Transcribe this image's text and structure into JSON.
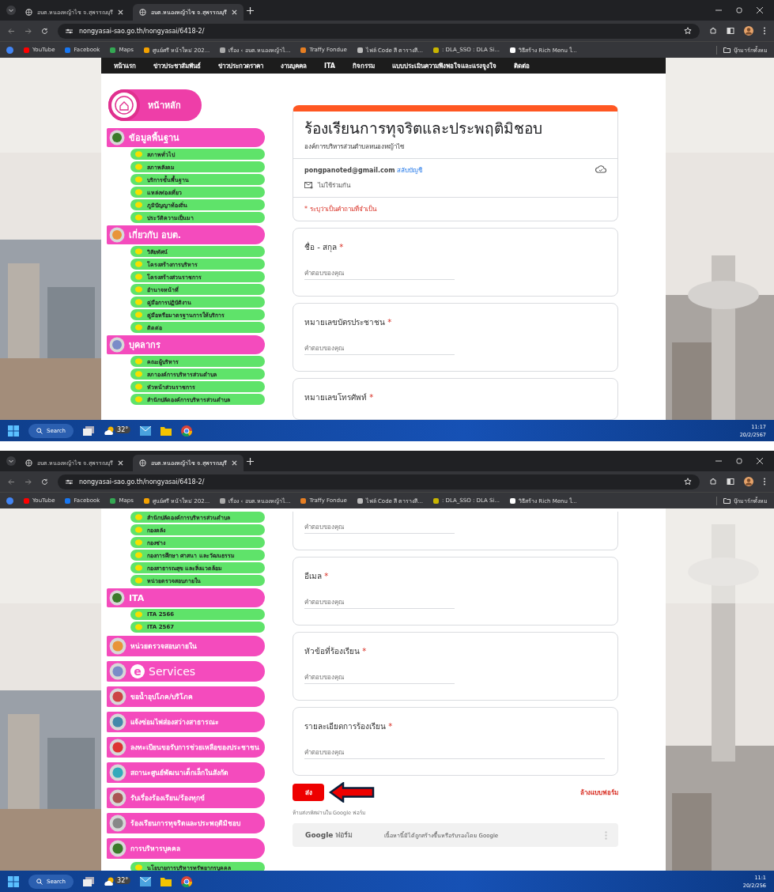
{
  "screens": [
    {
      "tabs": [
        {
          "title": "อบต.หนองหญ้าไซ จ.สุพรรณบุรี",
          "selected": false
        },
        {
          "title": "อบต.หนองหญ้าไซ จ.สุพรรณบุรี",
          "selected": true
        }
      ],
      "address": "nongyasai-sao.go.th/nongyasai/6418-2/",
      "bookmarks": [
        "YouTube",
        "Facebook",
        "Maps",
        "ศูนย์ศรี หน้าใหม่ 202...",
        "เรื่อง ‹ อบต.หนองหญ้าไ...",
        "Traffy Fondue",
        "ไฟล์ Code สี ตารางสี...",
        ": DLA_SSO : DLA Si...",
        "วิธีสร้าง Rich Menu ใ..."
      ],
      "all_bookmarks": "บุ๊กมาร์กทั้งหม",
      "nav": [
        "หน้าแรก",
        "ข่าวประชาสัมพันธ์",
        "ข่าวประกวดราคา",
        "งานบุคคล",
        "ITA",
        "กิจกรรม",
        "แบบประเมินความพึงพอใจและแรงจูงใจ",
        "ติดต่อ"
      ],
      "sidebar": [
        {
          "kind": "home",
          "label": "หน้าหลัก"
        },
        {
          "kind": "section",
          "label": "ข้อมูลพื้นฐาน"
        },
        {
          "kind": "item",
          "label": "สภาพทั่วไป"
        },
        {
          "kind": "item",
          "label": "สภาพสังคม"
        },
        {
          "kind": "item",
          "label": "บริการขั้นพื้นฐาน"
        },
        {
          "kind": "item",
          "label": "แหล่งท่องเที่ยว"
        },
        {
          "kind": "item",
          "label": "ภูมิปัญญาท้องถิ่น"
        },
        {
          "kind": "item",
          "label": "ประวัติความเป็นมา"
        },
        {
          "kind": "section",
          "label": "เกี่ยวกับ อบต."
        },
        {
          "kind": "item",
          "label": "วิสัยทัศน์"
        },
        {
          "kind": "item",
          "label": "โครงสร้างการบริหาร"
        },
        {
          "kind": "item",
          "label": "โครงสร้างส่วนราชการ"
        },
        {
          "kind": "item",
          "label": "อำนาจหน้าที่"
        },
        {
          "kind": "item",
          "label": "คู่มือการปฏิบัติงาน"
        },
        {
          "kind": "item",
          "label": "คู่มือหรือมาตรฐานการให้บริการ"
        },
        {
          "kind": "item",
          "label": "ติดต่อ"
        },
        {
          "kind": "section",
          "label": "บุคลากร"
        },
        {
          "kind": "item",
          "label": "คณะผู้บริหาร"
        },
        {
          "kind": "item",
          "label": "สภาองค์การบริหารส่วนตำบล"
        },
        {
          "kind": "item",
          "label": "หัวหน้าส่วนราชการ"
        },
        {
          "kind": "item",
          "label": "สำนักปลัดองค์การบริหารส่วนตำบล"
        }
      ],
      "form": [
        {
          "kind": "header",
          "title": "ร้องเรียนการทุจริตและประพฤติมิชอบ",
          "org": "องค์การบริหารส่วนตำบลหนองหญ้าไซ",
          "email": "pongpanoted@gmail.com",
          "switch": "สลับบัญชี",
          "share_note": "ไม่ใช้ร่วมกัน",
          "required_note": "* ระบุว่าเป็นคำถามที่จำเป็น"
        },
        {
          "kind": "question",
          "label": "ชื่อ - สกุล",
          "marker": "*",
          "placeholder": "คำตอบของคุณ"
        },
        {
          "kind": "question",
          "label": "หมายเลขบัตรประชาชน",
          "marker": "*",
          "placeholder": "คำตอบของคุณ"
        },
        {
          "kind": "question",
          "label": "หมายเลขโทรศัพท์",
          "marker": "*"
        }
      ],
      "taskbar": {
        "search": "Search",
        "weather": "32°",
        "time": "11:17",
        "date": "20/2/2567"
      }
    },
    {
      "tabs": [
        {
          "title": "อบต.หนองหญ้าไซ จ.สุพรรณบุรี",
          "selected": false
        },
        {
          "title": "อบต.หนองหญ้าไซ จ.สุพรรณบุรี",
          "selected": true
        }
      ],
      "address": "nongyasai-sao.go.th/nongyasai/6418-2/",
      "bookmarks": [
        "YouTube",
        "Facebook",
        "Maps",
        "ศูนย์ศรี หน้าใหม่ 202...",
        "เรื่อง ‹ อบต.หนองหญ้าไ...",
        "Traffy Fondue",
        "ไฟล์ Code สี ตารางสี...",
        ": DLA_SSO : DLA Si...",
        "วิธีสร้าง Rich Menu ใ..."
      ],
      "all_bookmarks": "บุ๊กมาร์กทั้งหม",
      "sidebar": [
        {
          "kind": "item",
          "label": "สำนักปลัดองค์การบริหารส่วนตำบล"
        },
        {
          "kind": "item",
          "label": "กองคลัง"
        },
        {
          "kind": "item",
          "label": "กองช่าง"
        },
        {
          "kind": "item",
          "label": "กองการศึกษา ศาสนา และวัฒนธรรม"
        },
        {
          "kind": "item",
          "label": "กองสาธารณสุข และสิ่งแวดล้อม"
        },
        {
          "kind": "item",
          "label": "หน่วยตรวจสอบภายใน"
        },
        {
          "kind": "section",
          "label": "ITA"
        },
        {
          "kind": "item",
          "label": "ITA 2566"
        },
        {
          "kind": "item",
          "label": "ITA 2567"
        },
        {
          "kind": "big",
          "label": "หน่วยตรวจสอบภายใน"
        },
        {
          "kind": "eservices",
          "logo": "e",
          "label": "Services"
        },
        {
          "kind": "big",
          "label": "ขอน้ำอุปโภค/บริโภค"
        },
        {
          "kind": "big",
          "label": "แจ้งซ่อมไฟส่องสว่างสาธารณะ"
        },
        {
          "kind": "big",
          "label": "ลงทะเบียนขอรับการช่วยเหลือของประชาชน"
        },
        {
          "kind": "big",
          "label": "สถานะศูนย์พัฒนาเด็กเล็กในสังกัด"
        },
        {
          "kind": "big",
          "label": "รับเรื่องร้องเรียน/ร้องทุกข์"
        },
        {
          "kind": "big",
          "label": "ร้องเรียนการทุจริตและประพฤติมิชอบ"
        },
        {
          "kind": "big",
          "label": "การบริหารบุคคล"
        },
        {
          "kind": "item",
          "label": "นโยบายการบริหารทรัพยากรบุคคล"
        }
      ],
      "form": [
        {
          "kind": "answer",
          "placeholder": "คำตอบของคุณ"
        },
        {
          "kind": "question",
          "label": "อีเมล",
          "marker": "*",
          "placeholder": "คำตอบของคุณ"
        },
        {
          "kind": "question",
          "label": "หัวข้อที่ร้องเรียน",
          "marker": "*",
          "placeholder": "คำตอบของคุณ"
        },
        {
          "kind": "question",
          "label": "รายละเอียดการร้องเรียน",
          "marker": "*",
          "placeholder": "คำตอบของคุณ",
          "wide": true
        },
        {
          "kind": "actions",
          "submit": "ส่ง",
          "clear": "ล้างแบบฟอร์ม",
          "pointer": true
        },
        {
          "kind": "note",
          "text": "ห้ามส่งรหัสผ่านใน Google ฟอร์ม"
        },
        {
          "kind": "footer",
          "brand": "**Google** ฟอร์ม",
          "disclaimer": "เนื้อหานี้มิได้ถูกสร้างขึ้นหรือรับรองโดย Google"
        }
      ],
      "taskbar": {
        "search": "Search",
        "weather": "32°",
        "time": "11:1",
        "date": "20/2/256"
      }
    }
  ]
}
